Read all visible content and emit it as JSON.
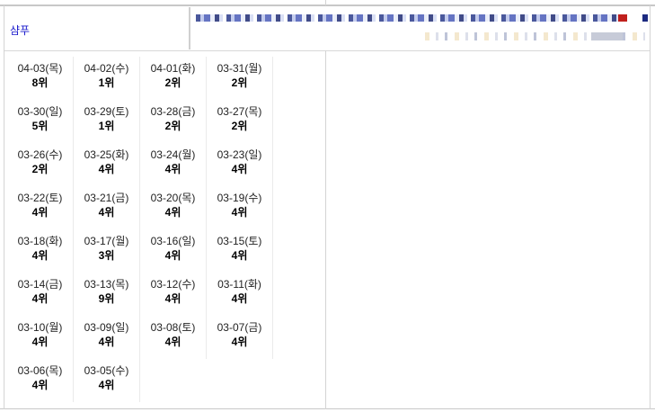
{
  "keyword": "샴푸",
  "rankings": [
    {
      "date": "04-03(목)",
      "rank": "8위"
    },
    {
      "date": "04-02(수)",
      "rank": "1위"
    },
    {
      "date": "04-01(화)",
      "rank": "2위"
    },
    {
      "date": "03-31(월)",
      "rank": "2위"
    },
    {
      "date": "03-30(일)",
      "rank": "5위"
    },
    {
      "date": "03-29(토)",
      "rank": "1위"
    },
    {
      "date": "03-28(금)",
      "rank": "2위"
    },
    {
      "date": "03-27(목)",
      "rank": "2위"
    },
    {
      "date": "03-26(수)",
      "rank": "2위"
    },
    {
      "date": "03-25(화)",
      "rank": "4위"
    },
    {
      "date": "03-24(월)",
      "rank": "4위"
    },
    {
      "date": "03-23(일)",
      "rank": "4위"
    },
    {
      "date": "03-22(토)",
      "rank": "4위"
    },
    {
      "date": "03-21(금)",
      "rank": "4위"
    },
    {
      "date": "03-20(목)",
      "rank": "4위"
    },
    {
      "date": "03-19(수)",
      "rank": "4위"
    },
    {
      "date": "03-18(화)",
      "rank": "4위"
    },
    {
      "date": "03-17(월)",
      "rank": "3위"
    },
    {
      "date": "03-16(일)",
      "rank": "4위"
    },
    {
      "date": "03-15(토)",
      "rank": "4위"
    },
    {
      "date": "03-14(금)",
      "rank": "4위"
    },
    {
      "date": "03-13(목)",
      "rank": "9위"
    },
    {
      "date": "03-12(수)",
      "rank": "4위"
    },
    {
      "date": "03-11(화)",
      "rank": "4위"
    },
    {
      "date": "03-10(월)",
      "rank": "4위"
    },
    {
      "date": "03-09(일)",
      "rank": "4위"
    },
    {
      "date": "03-08(토)",
      "rank": "4위"
    },
    {
      "date": "03-07(금)",
      "rank": "4위"
    },
    {
      "date": "03-06(목)",
      "rank": "4위"
    },
    {
      "date": "03-05(수)",
      "rank": "4위"
    }
  ]
}
